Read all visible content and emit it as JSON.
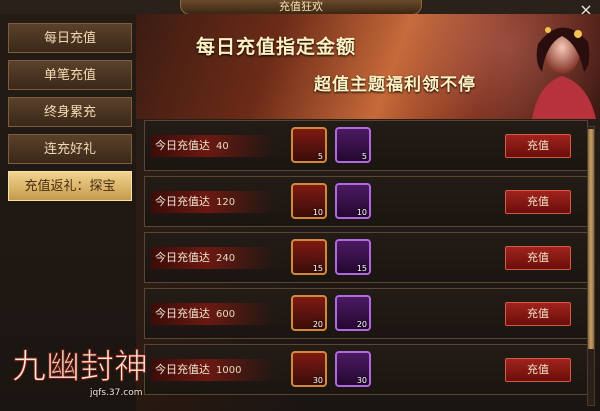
{
  "header": {
    "title": "充值狂欢",
    "close_label": "×"
  },
  "sidebar": {
    "items": [
      {
        "label": "每日充值"
      },
      {
        "label": "单笔充值"
      },
      {
        "label": "终身累充"
      },
      {
        "label": "连充好礼"
      },
      {
        "label": "充值返礼：探宝"
      }
    ],
    "active_index": 4
  },
  "banner": {
    "line1": "每日充值指定金额",
    "line2": "超值主题福利领不停"
  },
  "rows": [
    {
      "label": "今日充值达",
      "amount": "40",
      "items": [
        {
          "icon": "treasure-seal-icon",
          "count": "5"
        },
        {
          "icon": "blue-gem-chest-icon",
          "count": "5"
        }
      ],
      "button": "充值"
    },
    {
      "label": "今日充值达",
      "amount": "120",
      "items": [
        {
          "icon": "treasure-seal-icon",
          "count": "10"
        },
        {
          "icon": "blue-gem-chest-icon",
          "count": "10"
        }
      ],
      "button": "充值"
    },
    {
      "label": "今日充值达",
      "amount": "240",
      "items": [
        {
          "icon": "treasure-seal-icon",
          "count": "15"
        },
        {
          "icon": "blue-gem-chest-icon",
          "count": "15"
        }
      ],
      "button": "充值"
    },
    {
      "label": "今日充值达",
      "amount": "600",
      "items": [
        {
          "icon": "treasure-seal-icon",
          "count": "20"
        },
        {
          "icon": "blue-gem-chest-icon",
          "count": "20"
        }
      ],
      "button": "充值"
    },
    {
      "label": "今日充值达",
      "amount": "1000",
      "items": [
        {
          "icon": "treasure-seal-icon",
          "count": "30"
        },
        {
          "icon": "blue-gem-chest-icon",
          "count": "30"
        }
      ],
      "button": "充值"
    }
  ],
  "logo": {
    "text": "九幽封神",
    "url": "jqfs.37.com"
  },
  "colors": {
    "accent_gold": "#f2d48f",
    "button_red": "#a0241c"
  }
}
